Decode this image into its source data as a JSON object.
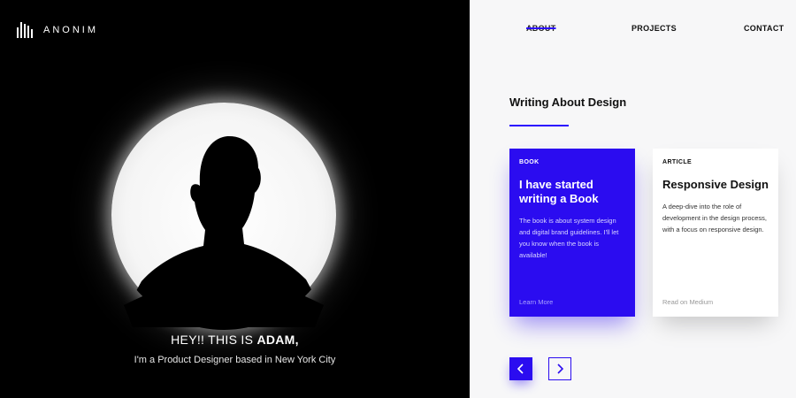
{
  "brand": {
    "name": "ANONIM",
    "icon": "building-bars-icon"
  },
  "nav": {
    "about": "ABOUT",
    "projects": "PROJECTS",
    "contact": "CONTACT"
  },
  "hero": {
    "greeting": "HEY!! THIS IS",
    "name": "ADAM,",
    "subtitle": "I'm a Product Designer based in New York City"
  },
  "section": {
    "title": "Writing About Design"
  },
  "cards": [
    {
      "tag": "BOOK",
      "title": "I have started writing a Book",
      "body": "The book is about system design and digital brand guidelines. I'll let you know when the book is available!",
      "link": "Learn More"
    },
    {
      "tag": "ARTICLE",
      "title": "Responsive Design",
      "body": "A deep-dive into the role of development in the design process, with a focus on responsive design.",
      "link": "Read on Medium"
    }
  ],
  "carousel": {
    "prev_icon": "chevron-left-icon",
    "next_icon": "chevron-right-icon"
  },
  "colors": {
    "accent": "#2b0cf0",
    "dark": "#000000",
    "light": "#f7f7f8"
  }
}
